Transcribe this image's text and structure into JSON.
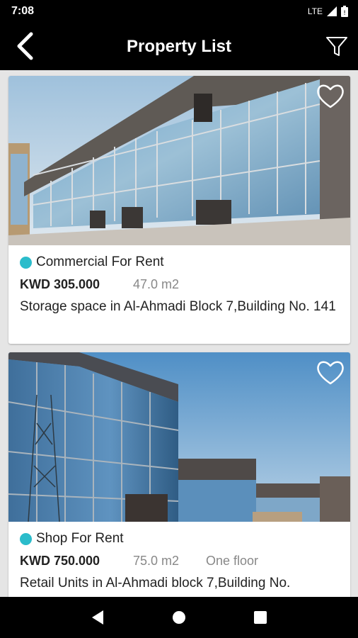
{
  "status_bar": {
    "time": "7:08",
    "network": "LTE"
  },
  "app_bar": {
    "title": "Property List",
    "back_icon": "back-arrow-icon",
    "filter_icon": "filter-icon"
  },
  "colors": {
    "accent_dot": "#2bbccb",
    "bar_bg": "#000000",
    "page_bg": "#e5e5e5"
  },
  "listings": [
    {
      "type": "Commercial For Rent",
      "price": "KWD 305.000",
      "area": "47.0 m2",
      "floor": "",
      "description": "Storage space in Al-Ahmadi Block 7,Building No. 141"
    },
    {
      "type": "Shop For Rent",
      "price": "KWD 750.000",
      "area": "75.0 m2",
      "floor": "One floor",
      "description": "Retail Units in Al-Ahmadi block 7,Building No."
    }
  ],
  "nav_bar": {
    "back": "nav-back-icon",
    "home": "nav-home-icon",
    "recents": "nav-recents-icon"
  }
}
